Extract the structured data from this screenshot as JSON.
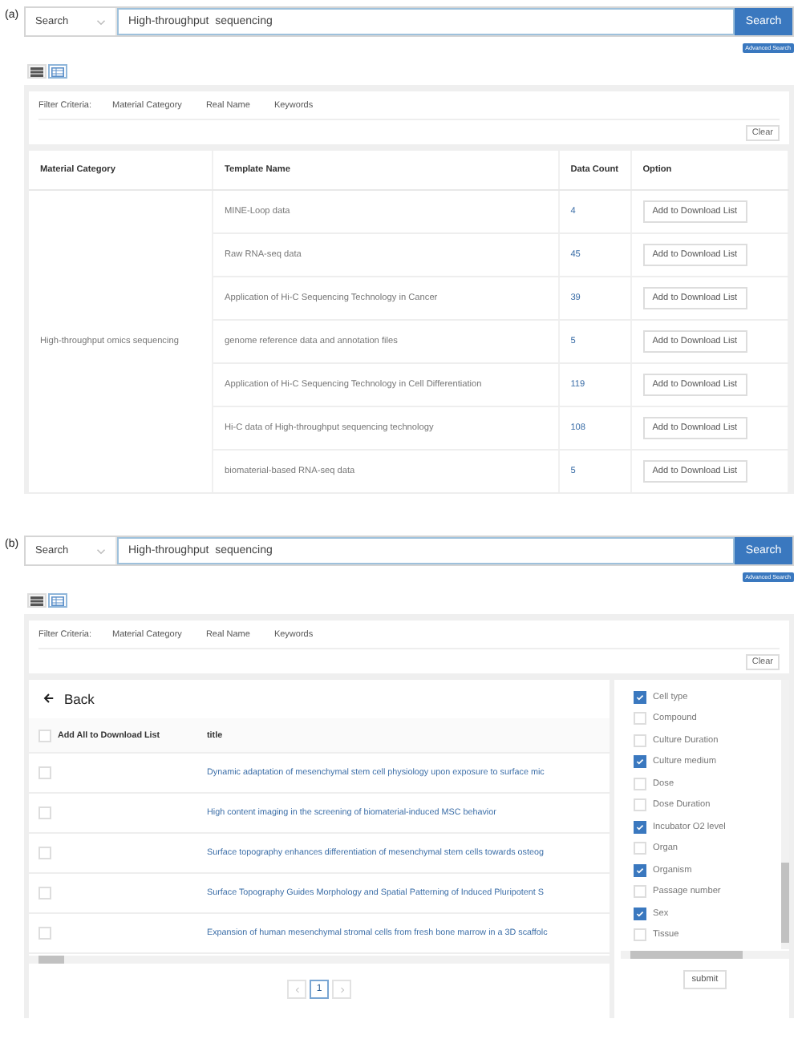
{
  "panels": [
    {
      "label": "(a)",
      "kind": "category_table",
      "search": {
        "scope": "Search",
        "query": "High-throughput  sequencing",
        "button": "Search",
        "advanced": "Advanced Search"
      },
      "view_toggle": [
        {
          "kind": "list",
          "selected": false
        },
        {
          "kind": "grid",
          "selected": true
        }
      ],
      "filter": {
        "label": "Filter Criteria:",
        "items": [
          "Material Category",
          "Real Name",
          "Keywords"
        ],
        "clear": "Clear"
      },
      "table": {
        "columns": [
          "Material Category",
          "Template Name",
          "Data Count",
          "Option"
        ],
        "category": "High-throughput omics sequencing",
        "rows": [
          {
            "template": "MINE-Loop data",
            "count": "4",
            "action": "Add to Download List"
          },
          {
            "template": "Raw RNA-seq data",
            "count": "45",
            "action": "Add to Download List"
          },
          {
            "template": "Application of Hi-C Sequencing Technology in Cancer",
            "count": "39",
            "action": "Add to Download List"
          },
          {
            "template": "genome reference data and annotation files",
            "count": "5",
            "action": "Add to Download List"
          },
          {
            "template": "Application of Hi-C Sequencing Technology in Cell Differentiation",
            "count": "119",
            "action": "Add to Download List"
          },
          {
            "template": "Hi-C data of High-throughput sequencing technology",
            "count": "108",
            "action": "Add to Download List"
          },
          {
            "template": "biomaterial-based RNA-seq data",
            "count": "5",
            "action": "Add to Download List"
          }
        ]
      }
    },
    {
      "label": "(b)",
      "kind": "results",
      "search": {
        "scope": "Search",
        "query": "High-throughput  sequencing",
        "button": "Search",
        "advanced": "Advanced Search"
      },
      "view_toggle": [
        {
          "kind": "list",
          "selected": false
        },
        {
          "kind": "grid",
          "selected": true
        }
      ],
      "filter": {
        "label": "Filter Criteria:",
        "items": [
          "Material Category",
          "Real Name",
          "Keywords"
        ],
        "clear": "Clear"
      },
      "results": {
        "back": "Back",
        "select_all": {
          "label": "Add All to Download List",
          "checked": false
        },
        "title_column": "title",
        "rows": [
          {
            "title": "Dynamic adaptation of mesenchymal stem cell physiology upon exposure to surface mic",
            "checked": false
          },
          {
            "title": "High content imaging in the screening of biomaterial-induced MSC behavior",
            "checked": false
          },
          {
            "title": "Surface topography enhances differentiation of mesenchymal stem cells towards osteog",
            "checked": false
          },
          {
            "title": "Surface Topography Guides Morphology and Spatial Patterning of Induced Pluripotent S",
            "checked": false
          },
          {
            "title": "Expansion of human mesenchymal stromal cells from fresh bone marrow in a 3D scaffolc",
            "checked": false
          }
        ],
        "pages": [
          {
            "label": "1",
            "selected": true
          }
        ]
      },
      "fields": {
        "items": [
          {
            "label": "Cell type",
            "checked": true
          },
          {
            "label": "Compound",
            "checked": false
          },
          {
            "label": "Culture Duration",
            "checked": false
          },
          {
            "label": "Culture medium",
            "checked": true
          },
          {
            "label": "Dose",
            "checked": false
          },
          {
            "label": "Dose Duration",
            "checked": false
          },
          {
            "label": "Incubator O2 level",
            "checked": true
          },
          {
            "label": "Organ",
            "checked": false
          },
          {
            "label": "Organism",
            "checked": true
          },
          {
            "label": "Passage number",
            "checked": false
          },
          {
            "label": "Sex",
            "checked": true
          },
          {
            "label": "Tissue",
            "checked": false
          }
        ],
        "submit": "submit"
      }
    }
  ]
}
